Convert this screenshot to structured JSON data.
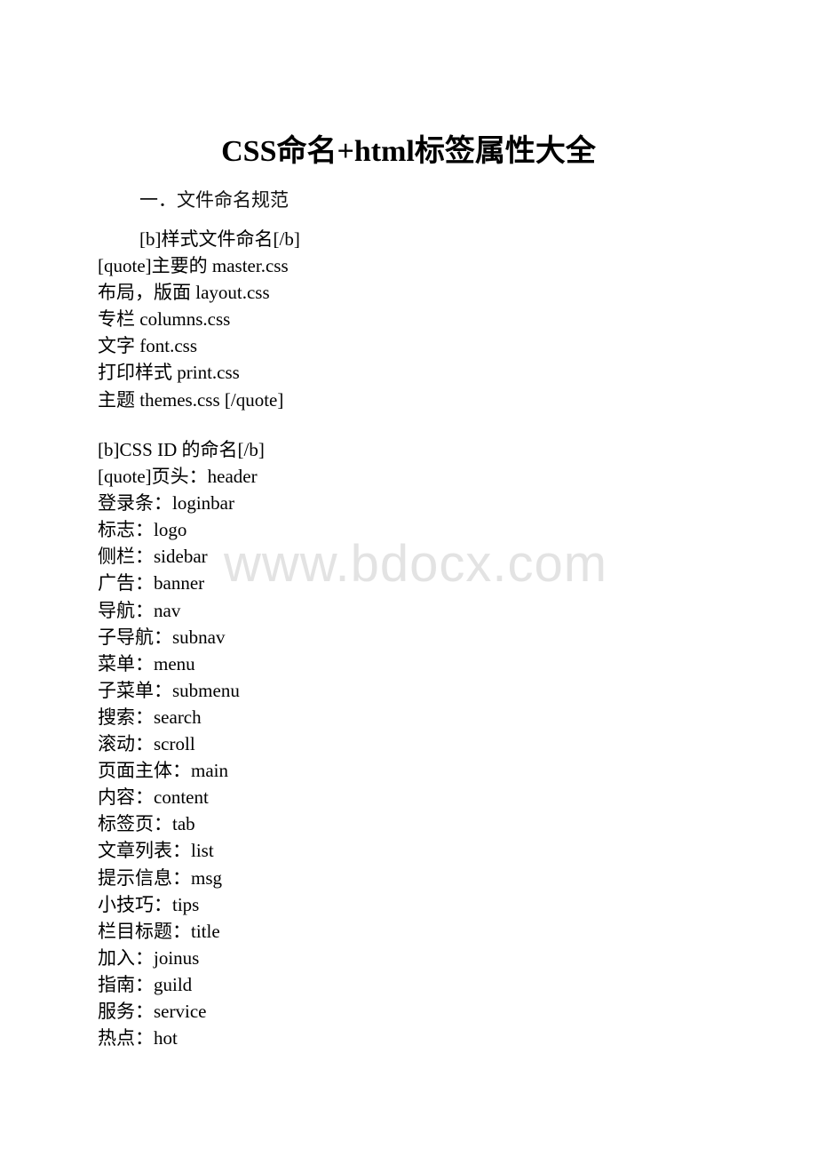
{
  "document": {
    "title": "CSS命名+html标签属性大全",
    "section_heading": "一．文件命名规范",
    "watermark": "www.bdocx.com",
    "style_files": {
      "heading": "[b]样式文件命名[/b]",
      "lines": [
        "[quote]主要的 master.css",
        "布局，版面 layout.css",
        "专栏 columns.css",
        "文字 font.css",
        "打印样式 print.css",
        "主题 themes.css [/quote]"
      ]
    },
    "css_ids": {
      "heading": "[b]CSS ID 的命名[/b]",
      "lines": [
        "[quote]页头：header",
        "登录条：loginbar",
        "标志：logo",
        "侧栏：sidebar",
        "广告：banner",
        "导航：nav",
        "子导航：subnav",
        "菜单：menu",
        "子菜单：submenu",
        "搜索：search",
        "滚动：scroll",
        "页面主体：main",
        "内容：content",
        "标签页：tab",
        "文章列表：list",
        "提示信息：msg",
        "小技巧：tips",
        "栏目标题：title",
        "加入：joinus",
        "指南：guild",
        "服务：service",
        "热点：hot"
      ]
    }
  }
}
